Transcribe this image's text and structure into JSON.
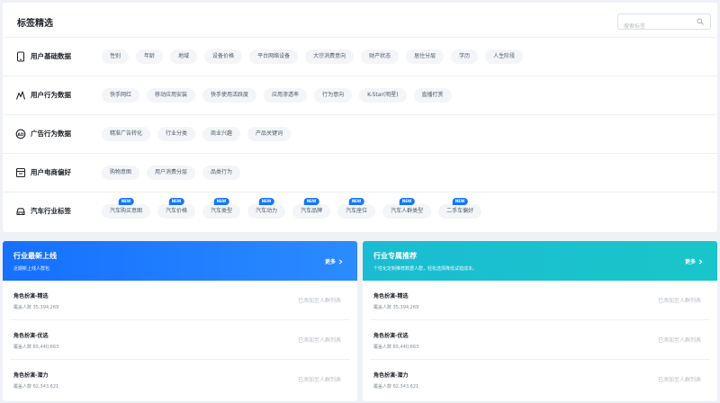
{
  "page_title": "标签精选",
  "search": {
    "placeholder": "搜索标签",
    "value": ""
  },
  "categories": [
    {
      "label": "用户基础数据",
      "icon": "phone-icon",
      "tags": [
        {
          "label": "性别"
        },
        {
          "label": "年龄"
        },
        {
          "label": "地域"
        },
        {
          "label": "设备价格"
        },
        {
          "label": "平台网络设备"
        },
        {
          "label": "大宗消费意向"
        },
        {
          "label": "财产状态"
        },
        {
          "label": "居住分层"
        },
        {
          "label": "学历"
        },
        {
          "label": "人生阶段"
        }
      ]
    },
    {
      "label": "用户行为数据",
      "icon": "activity-icon",
      "tags": [
        {
          "label": "快手网红"
        },
        {
          "label": "移动应用安装"
        },
        {
          "label": "快手使用活跃度"
        },
        {
          "label": "应用渗透率"
        },
        {
          "label": "行为意向"
        },
        {
          "label": "K-Star(明星)"
        },
        {
          "label": "直播打赏"
        }
      ]
    },
    {
      "label": "广告行为数据",
      "icon": "ad-icon",
      "tags": [
        {
          "label": "精准广告转化"
        },
        {
          "label": "行业分类"
        },
        {
          "label": "商业兴趣"
        },
        {
          "label": "产品关键词"
        }
      ]
    },
    {
      "label": "用户电商偏好",
      "icon": "store-icon",
      "tags": [
        {
          "label": "购物意图"
        },
        {
          "label": "用户消费分层"
        },
        {
          "label": "品类行为"
        }
      ]
    },
    {
      "label": "汽车行业标签",
      "icon": "car-icon",
      "tags": [
        {
          "label": "汽车购买意图",
          "badge": "NEW"
        },
        {
          "label": "汽车价格",
          "badge": "NEW"
        },
        {
          "label": "汽车类型",
          "badge": "NEW"
        },
        {
          "label": "汽车动力",
          "badge": "NEW"
        },
        {
          "label": "汽车品牌",
          "badge": "NEW"
        },
        {
          "label": "汽车座位",
          "badge": "NEW"
        },
        {
          "label": "汽车人群类型",
          "badge": "NEW"
        },
        {
          "label": "二手车偏好",
          "badge": "NEW"
        }
      ]
    }
  ],
  "panels": {
    "left": {
      "title": "行业最新上线",
      "subtitle": "近期新上线人群包",
      "more": "更多",
      "items": [
        {
          "name": "角色扮演-精选",
          "coverage": "覆盖人数 35,394,269",
          "status": "已添加至人群列表"
        },
        {
          "name": "角色扮演-优选",
          "coverage": "覆盖人数 65,440,663",
          "status": "已添加至人群列表"
        },
        {
          "name": "角色扮演-潜力",
          "coverage": "覆盖人数 82,343,621",
          "status": "已添加至人群列表"
        }
      ]
    },
    "right": {
      "title": "行业专属推荐",
      "subtitle": "个性化定制推荐数据人群，轻松选择降低试错成本。",
      "more": "更多",
      "items": [
        {
          "name": "角色扮演-精选",
          "coverage": "覆盖人数 35,394,269",
          "status": "已添加至人群列表"
        },
        {
          "name": "角色扮演-优选",
          "coverage": "覆盖人数 65,440,663",
          "status": "已添加至人群列表"
        },
        {
          "name": "角色扮演-潜力",
          "coverage": "覆盖人数 82,343,621",
          "status": "已添加至人群列表"
        }
      ]
    }
  },
  "colors": {
    "accent_blue": "#1677ff",
    "accent_teal": "#19c3cc",
    "tag_bg": "#f3f5f8",
    "page_bg": "#eef1f6"
  }
}
